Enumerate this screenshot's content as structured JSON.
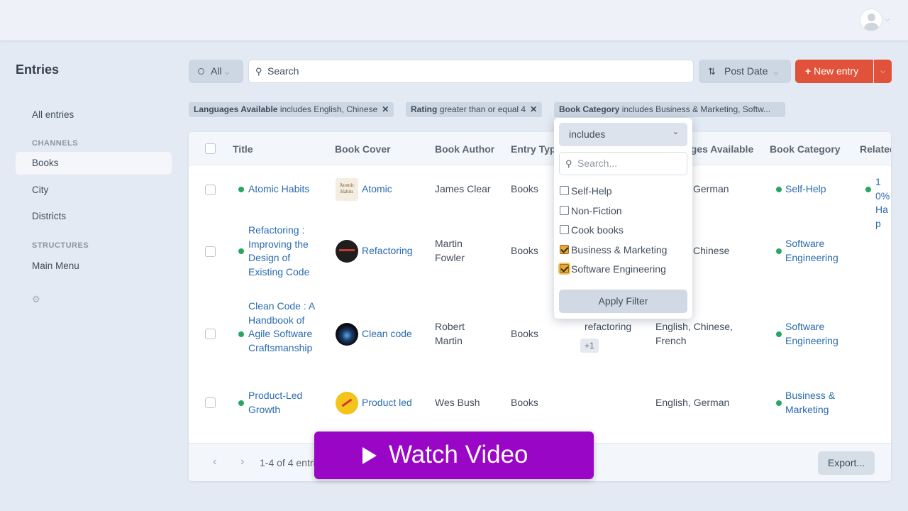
{
  "page": {
    "title": "Entries"
  },
  "sidebar": {
    "all_entries": "All entries",
    "channels_heading": "CHANNELS",
    "channels": [
      "Books",
      "City",
      "Districts"
    ],
    "structures_heading": "STRUCTURES",
    "structures": [
      "Main Menu"
    ],
    "settings_icon": "gear-icon"
  },
  "toolbar": {
    "status_label": "All",
    "search_placeholder": "Search",
    "sort_label": "Post Date",
    "new_entry_label": "New entry"
  },
  "filters": [
    {
      "field": "Languages Available",
      "op": "includes English, Chinese"
    },
    {
      "field": "Rating",
      "op": "greater than or equal 4"
    },
    {
      "field": "Book Category",
      "op": "includes Business & Marketing, Softw..."
    }
  ],
  "table": {
    "columns": [
      "Title",
      "Book Cover",
      "Book Author",
      "Entry Type",
      "Languages Available",
      "Book Category",
      "Related"
    ],
    "rows": [
      {
        "title": "Atomic Habits",
        "cover": "Atomic",
        "author": "James Clear",
        "type": "Books",
        "tags": "",
        "languages": "German",
        "category": "Self-Help",
        "related": "10% Hap"
      },
      {
        "title": "Refactoring : Improving the Design of Existing Code",
        "cover": "Refactoring",
        "author": "Martin Fowler",
        "type": "Books",
        "tags": "",
        "languages": "Chinese",
        "category": "Software Engineering",
        "related": ""
      },
      {
        "title": "Clean Code : A Handbook of Agile Software Craftsmanship",
        "cover": "Clean code",
        "author": "Robert Martin",
        "type": "Books",
        "tags": "refactoring",
        "tags_more": "+1",
        "languages": "English, Chinese, French",
        "category": "Software Engineering",
        "related": ""
      },
      {
        "title": "Product-Led Growth",
        "cover": "Product led",
        "author": "Wes Bush",
        "type": "Books",
        "tags": "",
        "languages": "English, German",
        "category": "Business & Marketing",
        "related": ""
      }
    ]
  },
  "footer": {
    "pagination": "1-4 of 4 entries",
    "export_label": "Export..."
  },
  "filter_dropdown": {
    "operator": "includes",
    "search_placeholder": "Search...",
    "options": [
      {
        "label": "Self-Help",
        "checked": false
      },
      {
        "label": "Non-Fiction",
        "checked": false
      },
      {
        "label": "Cook books",
        "checked": false
      },
      {
        "label": "Business & Marketing",
        "checked": true
      },
      {
        "label": "Software Engineering",
        "checked": true
      }
    ],
    "apply_label": "Apply Filter"
  },
  "overlay": {
    "watch_video": "Watch Video"
  },
  "colors": {
    "accent": "#e0533a",
    "link": "#2a6bb0",
    "status_green": "#27a761",
    "overlay_purple": "#9a06c6"
  }
}
